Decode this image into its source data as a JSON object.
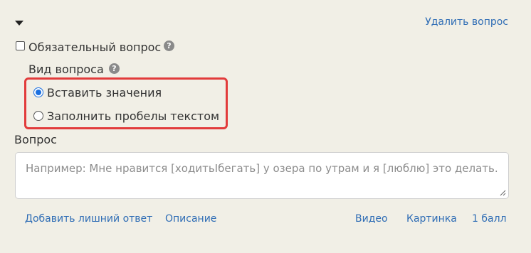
{
  "header": {
    "delete_question_label": "Удалить вопрос"
  },
  "required": {
    "label": "Обязательный вопрос",
    "checked": false,
    "help_icon": "question-circle-icon"
  },
  "question_type": {
    "label": "Вид вопроса",
    "help_icon": "question-circle-icon",
    "options": [
      {
        "label": "Вставить значения",
        "selected": true
      },
      {
        "label": "Заполнить пробелы текстом",
        "selected": false
      }
    ],
    "highlight_color": "#e23b3b"
  },
  "question": {
    "label": "Вопрос",
    "placeholder": "Например: Мне нравится [ходитьIбегать] у озера по утрам и я [люблю] это делать.",
    "value": ""
  },
  "footer": {
    "add_extra_answer": "Добавить лишний ответ",
    "description": "Описание",
    "video": "Видео",
    "image": "Картинка",
    "points": "1 балл"
  },
  "colors": {
    "background": "#f1efe6",
    "link": "#2f6db5",
    "radio_selected": "#1a6fe0"
  }
}
